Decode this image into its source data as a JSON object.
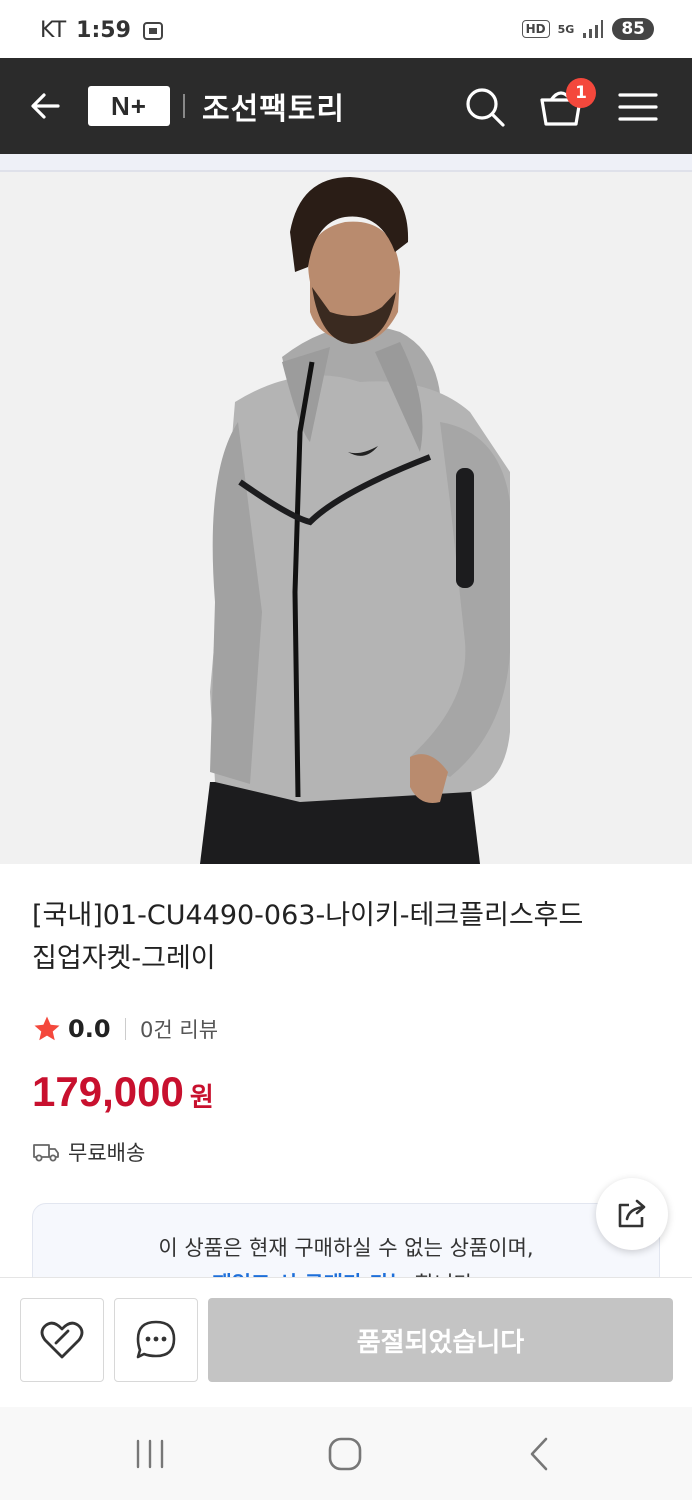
{
  "status_bar": {
    "carrier": "KT",
    "time": "1:59",
    "hd": "HD",
    "network": "5G",
    "battery": "85"
  },
  "header": {
    "logo_text": "N+",
    "brand_name": "조선팩토리",
    "cart_count": "1"
  },
  "product": {
    "title_line1": "[국내]01-CU4490-063-나이키-테크플리스후드",
    "title_line2": "집업자켓-그레이",
    "rating": "0.0",
    "review_count": "0건 리뷰",
    "price": "179,000",
    "price_unit": "원",
    "shipping": "무료배송"
  },
  "notice": {
    "line1": "이 상품은 현재 구매하실 수 없는 상품이며,",
    "line2_link": "재입고 시 구매가 가능",
    "line2_rest": "합니다."
  },
  "bottom": {
    "soldout_label": "품절되었습니다"
  },
  "colors": {
    "header_bg": "#2b2b2b",
    "price": "#c8102e",
    "badge": "#f4483c",
    "star": "#f4483c",
    "link": "#1e6fd9"
  }
}
